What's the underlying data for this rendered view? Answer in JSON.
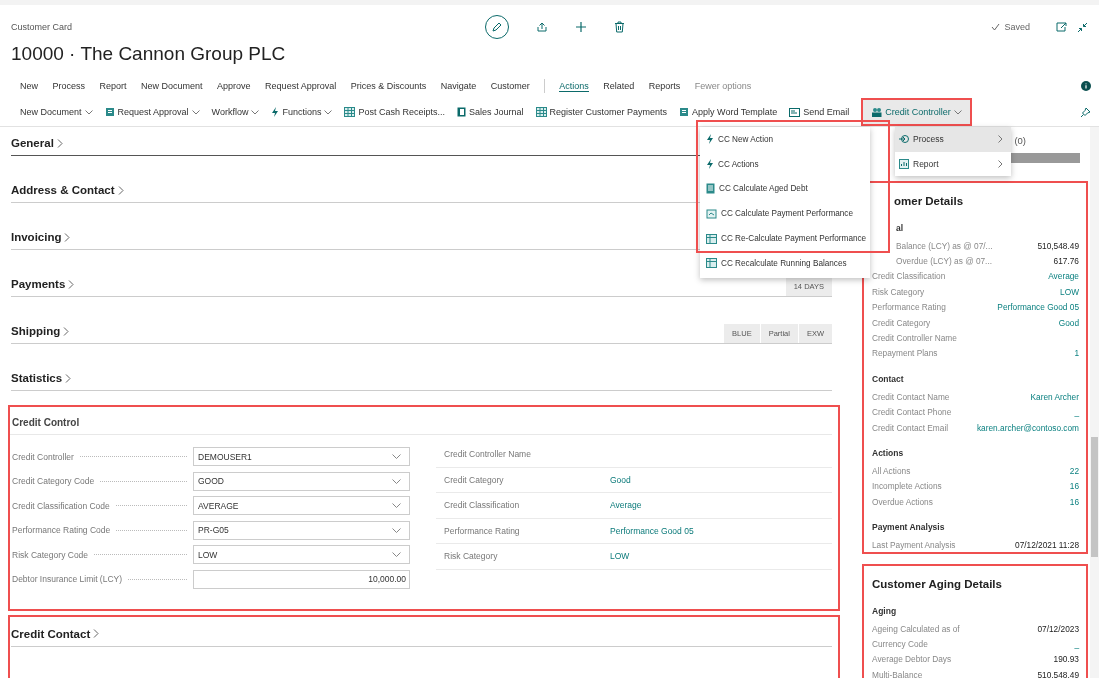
{
  "page": {
    "caption": "Customer Card",
    "title": "10000 · The Cannon Group PLC",
    "status": "Saved"
  },
  "promoted": [
    "New",
    "Process",
    "Report",
    "New Document",
    "Approve",
    "Request Approval",
    "Prices & Discounts",
    "Navigate",
    "Customer"
  ],
  "tabs": [
    {
      "label": "Actions",
      "selected": true
    },
    {
      "label": "Related",
      "selected": false
    },
    {
      "label": "Reports",
      "selected": false
    }
  ],
  "fewer_options": "Fewer options",
  "actions": [
    {
      "label": "New Document",
      "dropdown": true,
      "open": false
    },
    {
      "label": "Request Approval",
      "dropdown": true,
      "open": false
    },
    {
      "label": "Workflow",
      "dropdown": true,
      "open": false
    },
    {
      "label": "Functions",
      "dropdown": true,
      "open": false
    },
    {
      "label": "Post Cash Receipts...",
      "dropdown": false,
      "open": false
    },
    {
      "label": "Sales Journal",
      "dropdown": false,
      "open": false
    },
    {
      "label": "Register Customer Payments",
      "dropdown": false,
      "open": false
    },
    {
      "label": "Apply Word Template",
      "dropdown": false,
      "open": false
    },
    {
      "label": "Send Email",
      "dropdown": false,
      "open": false
    },
    {
      "label": "Credit Controller",
      "dropdown": true,
      "open": true
    }
  ],
  "submenu": [
    {
      "label": "Process",
      "selected": true
    },
    {
      "label": "Report",
      "selected": false
    }
  ],
  "menu": [
    "CC New Action",
    "CC Actions",
    "CC Calculate Aged Debt",
    "CC Calculate Payment Performance",
    "CC Re-Calculate Payment Performance",
    "CC Recalculate Running Balances"
  ],
  "sections": [
    {
      "title": "General"
    },
    {
      "title": "Address & Contact"
    },
    {
      "title": "Invoicing"
    },
    {
      "title": "Payments",
      "chips": [
        "14 DAYS"
      ]
    },
    {
      "title": "Shipping",
      "chips": [
        "BLUE",
        "Partial",
        "EXW"
      ]
    },
    {
      "title": "Statistics"
    }
  ],
  "credit_control": {
    "title": "Credit Control",
    "fields": [
      {
        "label": "Credit Controller",
        "value": "DEMOUSER1",
        "kind": "dropdown"
      },
      {
        "label": "Credit Category Code",
        "value": "GOOD",
        "kind": "dropdown"
      },
      {
        "label": "Credit Classification Code",
        "value": "AVERAGE",
        "kind": "dropdown"
      },
      {
        "label": "Performance Rating Code",
        "value": "PR-G05",
        "kind": "dropdown"
      },
      {
        "label": "Risk Category Code",
        "value": "LOW",
        "kind": "dropdown"
      },
      {
        "label": "Debtor Insurance Limit (LCY)",
        "value": "10,000.00",
        "kind": "number"
      }
    ],
    "info": [
      {
        "label": "Credit Controller Name"
      },
      {
        "label": "Credit Category",
        "value": "Good"
      },
      {
        "label": "Credit Classification",
        "value": "Average"
      },
      {
        "label": "Performance Rating",
        "value": "Performance Good 05"
      },
      {
        "label": "Risk Category",
        "value": "LOW"
      }
    ]
  },
  "credit_contact": {
    "title": "Credit Contact"
  },
  "factbox": {
    "count": "(0)",
    "details": {
      "title": "omer Details",
      "groups": [
        {
          "title": "al",
          "rows": [
            {
              "label": "Balance (LCY) as @ 07/...",
              "value": "510,548.49",
              "link": false
            },
            {
              "label": "Overdue (LCY) as @ 07...",
              "value": "617.76",
              "link": false
            },
            {
              "label": "Credit Classification",
              "value": "Average",
              "link": true
            },
            {
              "label": "Risk Category",
              "value": "LOW",
              "link": true
            },
            {
              "label": "Performance Rating",
              "value": "Performance Good 05",
              "link": true
            },
            {
              "label": "Credit Category",
              "value": "Good",
              "link": true
            },
            {
              "label": "Credit Controller Name"
            },
            {
              "label": "Repayment Plans",
              "value": "1",
              "link": true
            }
          ]
        },
        {
          "title": "Contact",
          "rows": [
            {
              "label": "Credit Contact Name",
              "value": "Karen Archer",
              "link": true
            },
            {
              "label": "Credit Contact Phone",
              "value": "_",
              "link": true
            },
            {
              "label": "Credit Contact Email",
              "value": "karen.archer@contoso.com",
              "link": true
            }
          ]
        },
        {
          "title": "Actions",
          "rows": [
            {
              "label": "All Actions",
              "value": "22",
              "link": true
            },
            {
              "label": "Incomplete Actions",
              "value": "16",
              "link": true
            },
            {
              "label": "Overdue Actions",
              "value": "16",
              "link": true
            }
          ]
        },
        {
          "title": "Payment Analysis",
          "rows": [
            {
              "label": "Last Payment Analysis",
              "value": "07/12/2021 11:28",
              "link": false
            }
          ]
        }
      ]
    },
    "aging": {
      "title": "Customer Aging Details",
      "groups": [
        {
          "title": "Aging",
          "rows": [
            {
              "label": "Ageing Calculated as of",
              "value": "07/12/2023",
              "link": false
            },
            {
              "label": "Currency Code",
              "value": "_",
              "link": true
            },
            {
              "label": "Average Debtor Days",
              "value": "190.93",
              "link": false
            },
            {
              "label": "Multi-Balance",
              "value": "510,548.49",
              "link": false
            }
          ]
        }
      ]
    }
  }
}
